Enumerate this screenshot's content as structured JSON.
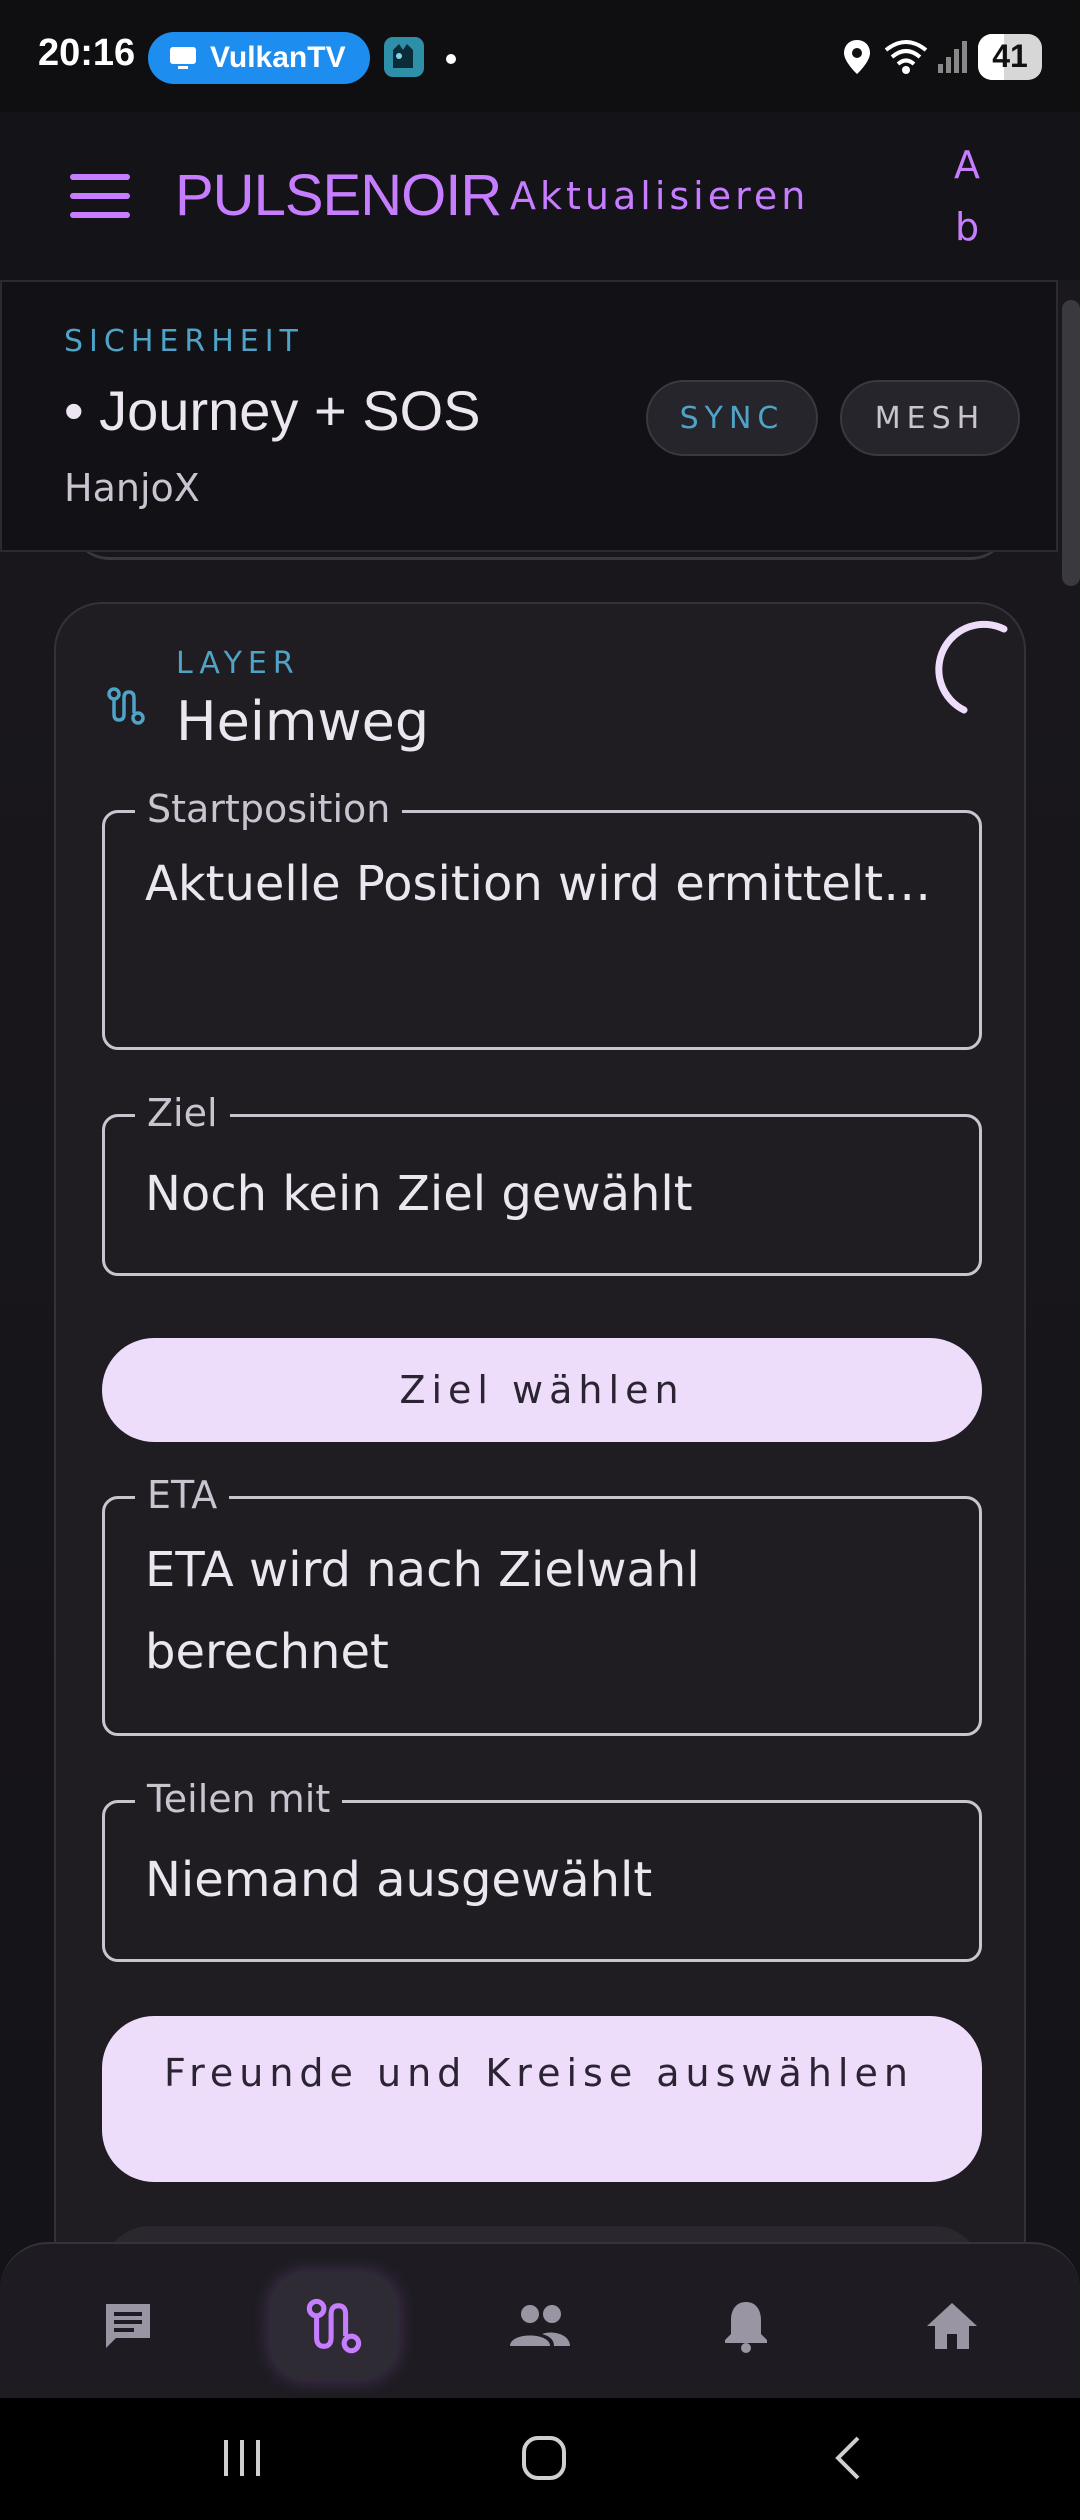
{
  "status_bar": {
    "time": "20:16",
    "cast_app": "VulkanTV",
    "battery": "41",
    "battery_fraction": 0.41,
    "icons": [
      "cast-icon",
      "app-notification-icon",
      "location-icon",
      "wifi-icon",
      "signal-icon",
      "battery-icon"
    ]
  },
  "app_bar": {
    "title": "PULSENOIR",
    "refresh_label": "Aktualisieren",
    "ab_top": "A",
    "ab_bottom": "b"
  },
  "summary": {
    "overline": "SICHERHEIT",
    "title": "• Journey + SOS",
    "user": "HanjoX",
    "chips": [
      "SYNC",
      "MESH"
    ]
  },
  "journey_card": {
    "overline": "LAYER",
    "title": "Heimweg",
    "fields": [
      {
        "label": "Startposition",
        "value": "Aktuelle Position wird ermittelt…"
      },
      {
        "label": "Ziel",
        "value": "Noch kein Ziel gewählt"
      },
      {
        "label": "ETA",
        "value": "ETA wird nach Zielwahl berechnet"
      },
      {
        "label": "Teilen mit",
        "value": "Niemand ausgewählt"
      }
    ],
    "choose_destination_button": "Ziel wählen",
    "choose_friends_button": "Freunde und Kreise auswählen"
  },
  "bottom_nav": {
    "items": [
      "chat-icon",
      "route-icon",
      "people-icon",
      "notifications-icon",
      "home-icon"
    ],
    "active_index": 1
  },
  "colors": {
    "accent": "#C77DFF",
    "overline": "#4FA3C7",
    "button_bg": "#EEDCFB",
    "background": "#141317"
  }
}
